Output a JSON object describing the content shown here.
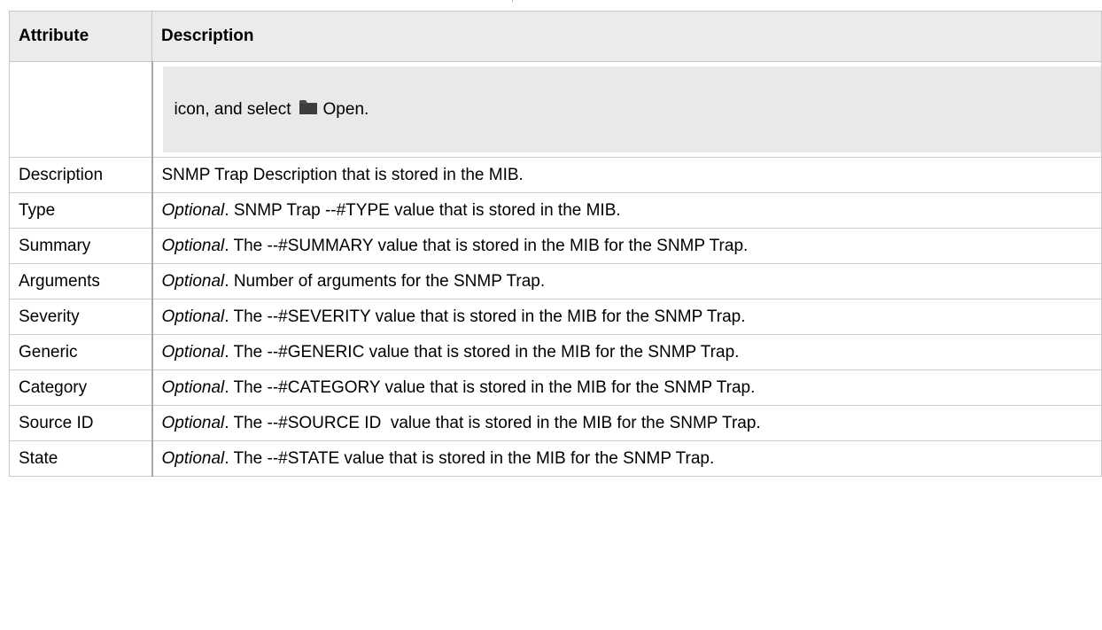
{
  "table": {
    "headers": [
      "Attribute",
      "Description"
    ],
    "note": {
      "attribute": "",
      "text_before": "icon, and select",
      "icon": "folder-icon",
      "text_after": "Open."
    },
    "rows": [
      {
        "attribute": "Description",
        "optional": "",
        "text": "SNMP Trap Description that is stored in the MIB."
      },
      {
        "attribute": "Type",
        "optional": "Optional",
        "text": ". SNMP Trap --#TYPE value that is stored in the MIB."
      },
      {
        "attribute": "Summary",
        "optional": "Optional",
        "text": ". The --#SUMMARY value that is stored in the MIB for the SNMP Trap."
      },
      {
        "attribute": "Arguments",
        "optional": "Optional",
        "text": ". Number of arguments for the SNMP Trap."
      },
      {
        "attribute": "Severity",
        "optional": "Optional",
        "text": ". The --#SEVERITY value that is stored in the MIB for the SNMP Trap."
      },
      {
        "attribute": "Generic",
        "optional": "Optional",
        "text": ". The --#GENERIC value that is stored in the MIB for the SNMP Trap."
      },
      {
        "attribute": "Category",
        "optional": "Optional",
        "text": ". The --#CATEGORY value that is stored in the MIB for the SNMP Trap."
      },
      {
        "attribute": "Source ID",
        "optional": "Optional",
        "text": ". The --#SOURCE ID  value that is stored in the MIB for the SNMP Trap."
      },
      {
        "attribute": "State",
        "optional": "Optional",
        "text": ". The --#STATE value that is stored in the MIB for the SNMP Trap."
      }
    ]
  },
  "colors": {
    "header_bg": "#ebebeb",
    "note_bg": "#e8eae7",
    "border": "#c8c8c8",
    "icon": "#4a4a4a"
  }
}
